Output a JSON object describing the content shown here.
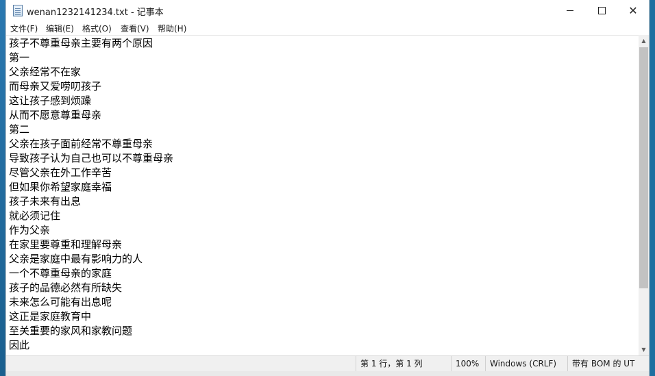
{
  "window": {
    "title": "wenan1232141234.txt - 记事本",
    "controls": {
      "minimize": "—",
      "maximize": "□",
      "close": "✕"
    }
  },
  "menu": [
    {
      "label": "文件(F)"
    },
    {
      "label": "编辑(E)"
    },
    {
      "label": "格式(O)"
    },
    {
      "label": "查看(V)"
    },
    {
      "label": "帮助(H)"
    }
  ],
  "editor": {
    "lines": [
      "孩子不尊重母亲主要有两个原因",
      "第一",
      "父亲经常不在家",
      "而母亲又爱唠叨孩子",
      "这让孩子感到烦躁",
      "从而不愿意尊重母亲",
      "第二",
      "父亲在孩子面前经常不尊重母亲",
      "导致孩子认为自己也可以不尊重母亲",
      "尽管父亲在外工作辛苦",
      "但如果你希望家庭幸福",
      "孩子未来有出息",
      "就必须记住",
      "作为父亲",
      "在家里要尊重和理解母亲",
      "父亲是家庭中最有影响力的人",
      "一个不尊重母亲的家庭",
      "孩子的品德必然有所缺失",
      "未来怎么可能有出息呢",
      "这正是家庭教育中",
      "至关重要的家风和家教问题",
      "因此"
    ]
  },
  "scrollbar": {
    "up_arrow": "▲",
    "down_arrow": "▼",
    "position": 0.0
  },
  "status": {
    "position": "第 1 行，第 1 列",
    "zoom": "100%",
    "line_ending": "Windows (CRLF)",
    "encoding": "带有 BOM 的 UT"
  }
}
